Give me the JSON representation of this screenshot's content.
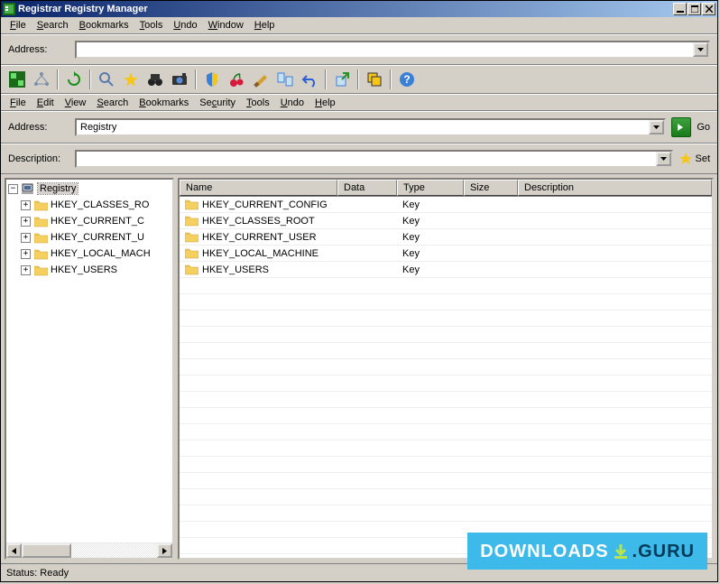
{
  "window": {
    "title": "Registrar Registry Manager"
  },
  "winctrl": {
    "min": "_",
    "max": "□",
    "close": "✕"
  },
  "top_menu": {
    "file": "File",
    "search": "Search",
    "bookmarks": "Bookmarks",
    "tools": "Tools",
    "undo": "Undo",
    "window": "Window",
    "help": "Help"
  },
  "sub_menu": {
    "file": "File",
    "edit": "Edit",
    "view": "View",
    "search": "Search",
    "bookmarks": "Bookmarks",
    "security": "Security",
    "tools": "Tools",
    "undo": "Undo",
    "help": "Help"
  },
  "address_top": {
    "label": "Address:",
    "value": ""
  },
  "address": {
    "label": "Address:",
    "value": "Registry"
  },
  "description": {
    "label": "Description:",
    "value": ""
  },
  "buttons": {
    "go": "Go",
    "set": "Set"
  },
  "tree": {
    "root": "Registry",
    "items": [
      "HKEY_CLASSES_ROOT",
      "HKEY_CURRENT_CONFIG",
      "HKEY_CURRENT_USER",
      "HKEY_LOCAL_MACHINE",
      "HKEY_USERS"
    ],
    "items_trunc": [
      "HKEY_CLASSES_RO",
      "HKEY_CURRENT_C",
      "HKEY_CURRENT_U",
      "HKEY_LOCAL_MACH",
      "HKEY_USERS"
    ]
  },
  "columns": {
    "name": "Name",
    "data": "Data",
    "type": "Type",
    "size": "Size",
    "description": "Description"
  },
  "rows": [
    {
      "name": "HKEY_CURRENT_CONFIG",
      "type": "Key"
    },
    {
      "name": "HKEY_CLASSES_ROOT",
      "type": "Key"
    },
    {
      "name": "HKEY_CURRENT_USER",
      "type": "Key"
    },
    {
      "name": "HKEY_LOCAL_MACHINE",
      "type": "Key"
    },
    {
      "name": "HKEY_USERS",
      "type": "Key"
    }
  ],
  "status": {
    "text": "Status: Ready"
  },
  "watermark": {
    "left": "DOWNLOADS",
    "right": ".GURU"
  }
}
